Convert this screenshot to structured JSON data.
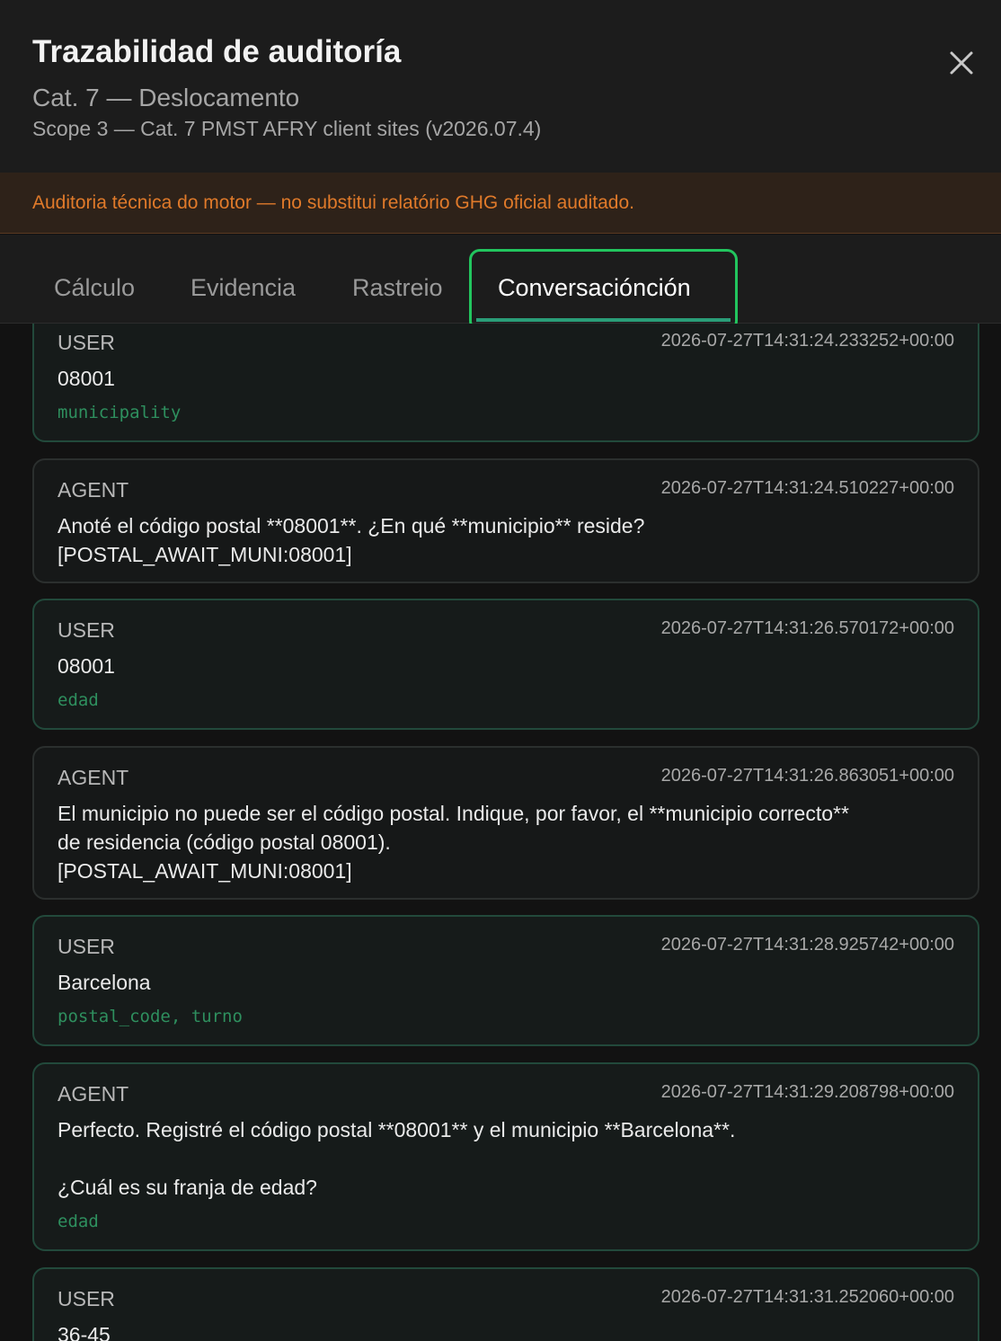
{
  "header": {
    "title": "Trazabilidad de auditoría",
    "subtitle": "Cat. 7 — Deslocamento",
    "scope": "Scope 3 — Cat. 7 PMST AFRY client sites (v2026.07.4)"
  },
  "banner": {
    "text": "Auditoria técnica do motor — no substitui relatório GHG oficial auditado."
  },
  "tabs": [
    {
      "label": "Cálculo"
    },
    {
      "label": "Evidencia"
    },
    {
      "label": "Rastreio"
    },
    {
      "label": "Conversaciónción",
      "active": true
    }
  ],
  "messages": [
    {
      "role": "USER",
      "timestamp": "2026-07-27T14:31:24.233252+00:00",
      "text": "08001",
      "tag": "municipality"
    },
    {
      "role": "AGENT",
      "timestamp": "2026-07-27T14:31:24.510227+00:00",
      "text": "Anoté el código postal **08001**. ¿En qué **municipio** reside?\n[POSTAL_AWAIT_MUNI:08001]"
    },
    {
      "role": "USER",
      "timestamp": "2026-07-27T14:31:26.570172+00:00",
      "text": "08001",
      "tag": "edad"
    },
    {
      "role": "AGENT",
      "timestamp": "2026-07-27T14:31:26.863051+00:00",
      "text": "El municipio no puede ser el código postal. Indique, por favor, el **municipio correcto**\nde residencia (código postal 08001).\n[POSTAL_AWAIT_MUNI:08001]"
    },
    {
      "role": "USER",
      "timestamp": "2026-07-27T14:31:28.925742+00:00",
      "text": "Barcelona",
      "tag": "postal_code, turno"
    },
    {
      "role": "AGENT",
      "timestamp": "2026-07-27T14:31:29.208798+00:00",
      "text": "Perfecto. Registré el código postal **08001** y el municipio **Barcelona**.\n\n¿Cuál es su franja de edad?",
      "tag": "edad"
    },
    {
      "role": "USER",
      "timestamp": "2026-07-27T14:31:31.252060+00:00",
      "text": "36-45"
    }
  ]
}
